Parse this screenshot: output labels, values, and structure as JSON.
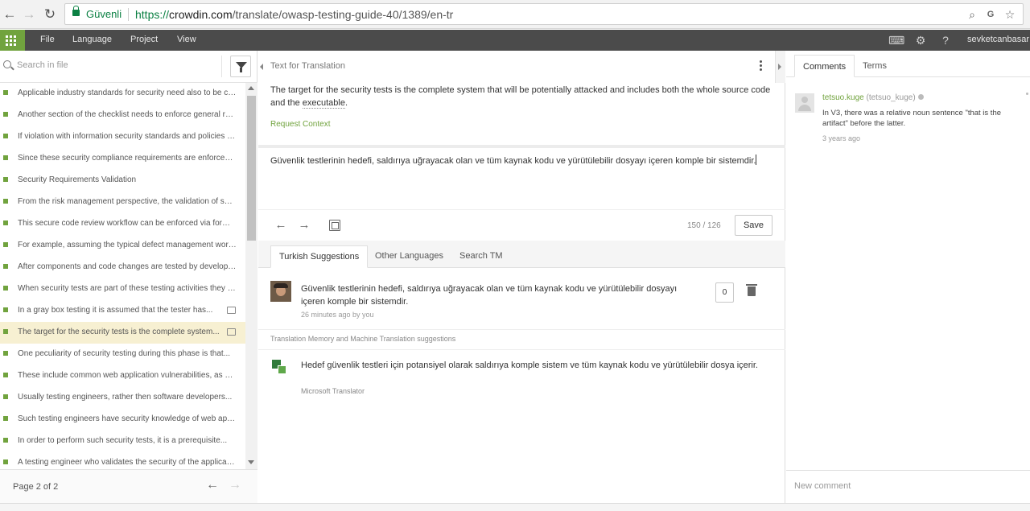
{
  "browser": {
    "secure_label": "Güvenli",
    "url_scheme": "https://",
    "url_domain": "crowdin.com",
    "url_path": "/translate/owasp-testing-guide-40/1389/en-tr",
    "icons": [
      "back-icon",
      "forward-icon",
      "reload-icon",
      "zoom-icon",
      "translate-icon",
      "star-icon"
    ]
  },
  "menu": {
    "items": [
      "File",
      "Language",
      "Project",
      "View"
    ],
    "user": "sevketcanbasar"
  },
  "left_panel": {
    "search_placeholder": "Search in file",
    "strings": [
      {
        "text": "Applicable industry standards for security need also to be captured...",
        "comment": false,
        "active": false
      },
      {
        "text": "Another section of the checklist needs to enforce general requirements...",
        "comment": false,
        "active": false
      },
      {
        "text": "If violation with information security standards and policies are found...",
        "comment": false,
        "active": false
      },
      {
        "text": "Since these security compliance requirements are enforceable...",
        "comment": false,
        "active": false
      },
      {
        "text": "Security Requirements Validation",
        "comment": false,
        "active": false
      },
      {
        "text": "From the risk management perspective, the validation of security requirements...",
        "comment": false,
        "active": false
      },
      {
        "text": "This secure code review workflow can be enforced via formal acceptance...",
        "comment": false,
        "active": false
      },
      {
        "text": "For example, assuming the typical defect management workflow...",
        "comment": false,
        "active": false
      },
      {
        "text": "After components and code changes are tested by developers...",
        "comment": false,
        "active": false
      },
      {
        "text": "When security tests are part of these testing activities they can be used...",
        "comment": false,
        "active": false
      },
      {
        "text": "In a gray box testing it is assumed that the tester has...",
        "comment": true,
        "active": false
      },
      {
        "text": "The target for the security tests is the complete system...",
        "comment": true,
        "active": true
      },
      {
        "text": "One peculiarity of security testing during this phase is that...",
        "comment": false,
        "active": false
      },
      {
        "text": "These include common web application vulnerabilities, as well as...",
        "comment": false,
        "active": false
      },
      {
        "text": "Usually testing engineers, rather then software developers...",
        "comment": false,
        "active": false
      },
      {
        "text": "Such testing engineers have security knowledge of web application...",
        "comment": false,
        "active": false
      },
      {
        "text": "In order to perform such security tests, it is a prerequisite...",
        "comment": false,
        "active": false
      },
      {
        "text": "A testing engineer who validates the security of the application...",
        "comment": false,
        "active": false
      }
    ],
    "page_info": "Page 2 of 2"
  },
  "editor": {
    "source_header": "Text for Translation",
    "source_text_before": "The target for the security tests is the complete system that will be potentially attacked and includes both the whole source code and the ",
    "source_text_term": "executable",
    "source_text_after": ".",
    "request_context": "Request Context",
    "translation": "Güvenlik testlerinin hedefi, saldırıya uğrayacak olan ve tüm kaynak kodu ve yürütülebilir dosyayı içeren komple bir sistemdir.",
    "char_count": "150 / 126",
    "save_label": "Save"
  },
  "suggestions": {
    "tabs": [
      "Turkish Suggestions",
      "Other Languages",
      "Search TM"
    ],
    "active_tab": "Turkish Suggestions",
    "user_suggestion": {
      "text": "Güvenlik testlerinin hedefi, saldırıya uğrayacak olan ve tüm kaynak kodu ve yürütülebilir dosyayı içeren komple bir sistemdir.",
      "meta": "26 minutes ago by you",
      "votes": "0"
    },
    "tm_heading": "Translation Memory and Machine Translation suggestions",
    "mt": {
      "text": "Hedef güvenlik testleri için potansiyel olarak saldırıya komple sistem ve tüm kaynak kodu ve yürütülebilir dosya içerir.",
      "provider": "Microsoft Translator"
    }
  },
  "right_panel": {
    "tabs": [
      "Comments",
      "Terms"
    ],
    "comment": {
      "author": "tetsuo.kuge",
      "handle": "(tetsuo_kuge)",
      "text": "In V3, there was a relative noun sentence \"that is the artifact\" before the latter.",
      "time": "3 years ago"
    },
    "new_comment_placeholder": "New comment"
  },
  "colors": {
    "accent_green": "#71a33e",
    "menu_bar": "#4b4b4b",
    "active_row": "#f7f0d2",
    "secure_green": "#0b8043"
  }
}
